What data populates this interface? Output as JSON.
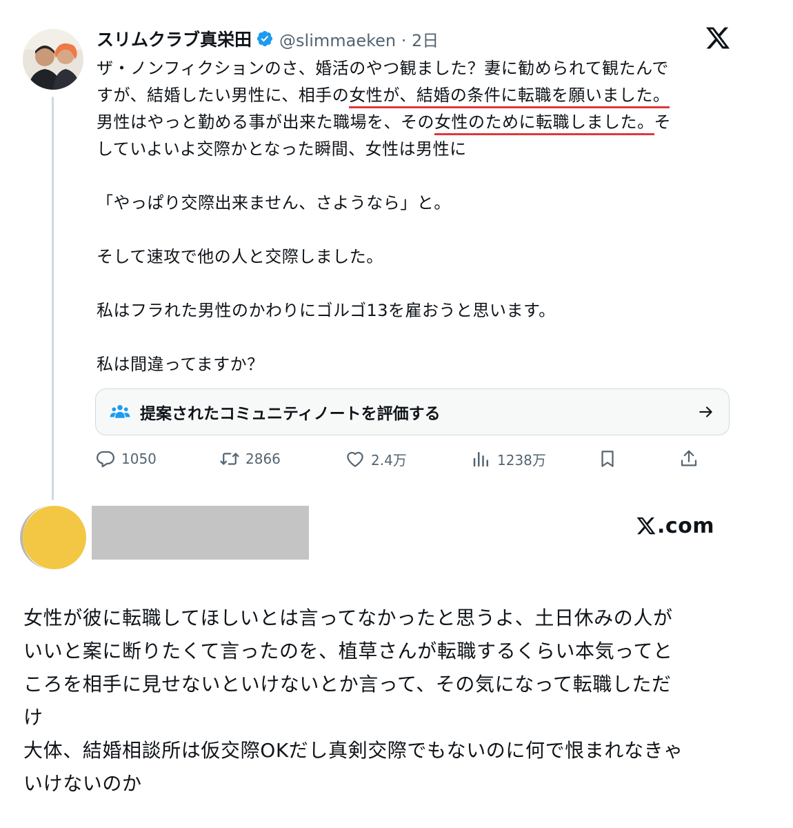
{
  "tweet": {
    "author": {
      "display_name": "スリムクラブ真栄田",
      "handle_time": "@slimmaeken · 2日",
      "avatar_icon": "user-photo-avatar",
      "verified_color": "#1d9bf0"
    },
    "platform_icon": "x-logo-icon",
    "body_lines": [
      "ザ・ノンフィクションのさ、婚活のやつ観ました？妻に勧められて観たんで",
      "すが、結婚したい男性に、相手の",
      "女性が、結婚の条件に転職を願いました。",
      "男性はやっと勤める事が出来た職場を、その",
      "女性のために転職しました。",
      "そ",
      "していよいよ交際かとなった瞬間、女性は男性に",
      "「やっぱり交際出来ません、さようなら」と。",
      "そして速攻で他の人と交際しました。",
      "私はフラれた男性のかわりにゴルゴ13を雇おうと思います。",
      "私は間違ってますか？"
    ],
    "underline_color": "#e0363b",
    "community_note": {
      "label": "提案されたコミュニティノートを評価する",
      "icon": "people-group-icon",
      "arrow_icon": "arrow-right-icon",
      "icon_color": "#1d9bf0"
    },
    "actions": {
      "replies": "1050",
      "retweets": "2866",
      "likes": "2.4万",
      "views": "1238万"
    }
  },
  "reply": {
    "avatar_color": "#f3c744",
    "name_redacted_color": "#c4c4c4",
    "source_logo": ".com",
    "body_lines": [
      "女性が彼に転職してほしいとは言ってなかったと思うよ、土日休みの人が",
      "いいと案に断りたくて言ったのを、植草さんが転職するくらい本気ってと",
      "ころを相手に見せないといけないとか言って、その気になって転職しただ",
      "け",
      "大体、結婚相談所は仮交際OKだし真剣交際でもないのに何で恨まれなきゃ",
      "いけないのか"
    ]
  }
}
